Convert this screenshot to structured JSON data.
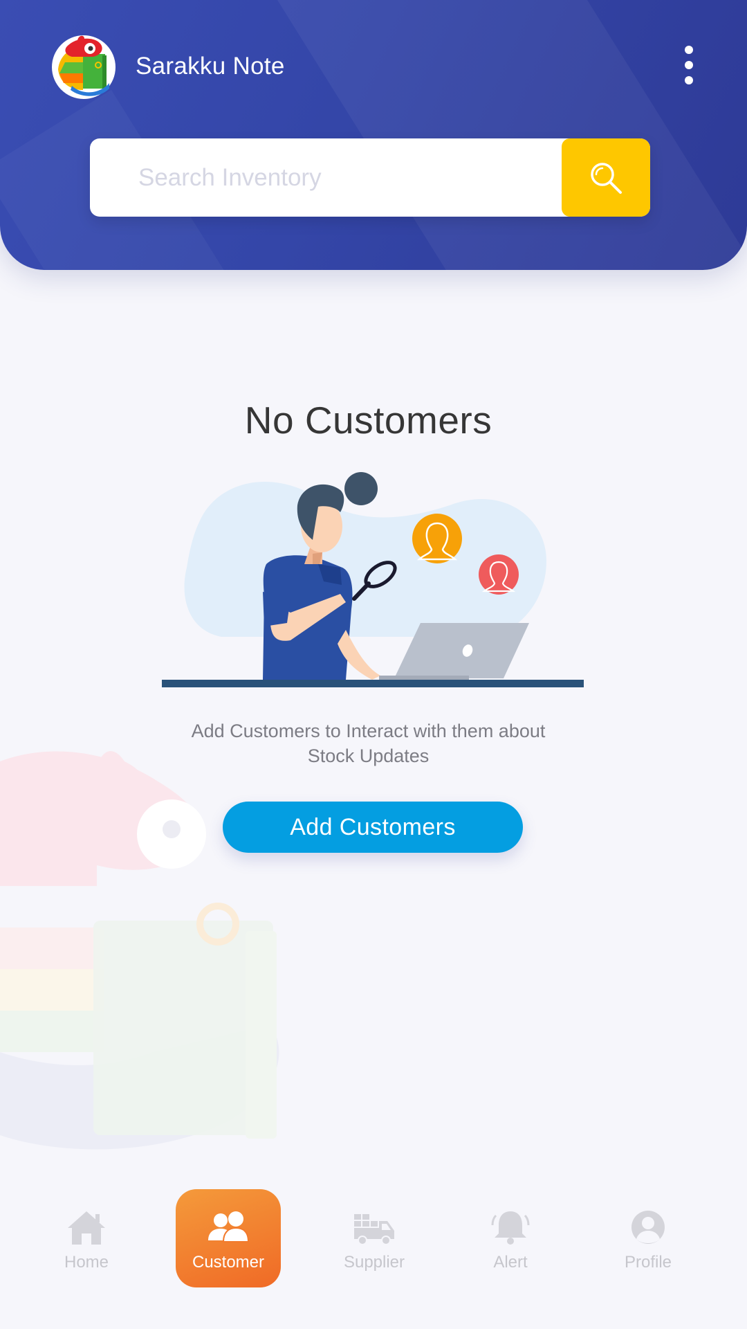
{
  "header": {
    "app_title": "Sarakku Note",
    "search_placeholder": "Search Inventory",
    "search_value": ""
  },
  "empty_state": {
    "title": "No Customers",
    "description": "Add Customers to Interact with them about Stock Updates",
    "button_label": "Add Customers"
  },
  "bottom_nav": {
    "items": [
      {
        "label": "Home",
        "icon": "home-icon",
        "active": false
      },
      {
        "label": "Customer",
        "icon": "customers-icon",
        "active": true
      },
      {
        "label": "Supplier",
        "icon": "truck-icon",
        "active": false
      },
      {
        "label": "Alert",
        "icon": "bell-icon",
        "active": false
      },
      {
        "label": "Profile",
        "icon": "profile-icon",
        "active": false
      }
    ]
  },
  "colors": {
    "header": "#3446a8",
    "search_button": "#fec700",
    "primary_button": "#049ee1",
    "active_tab": "#f0762b",
    "background": "#f6f6fb"
  }
}
